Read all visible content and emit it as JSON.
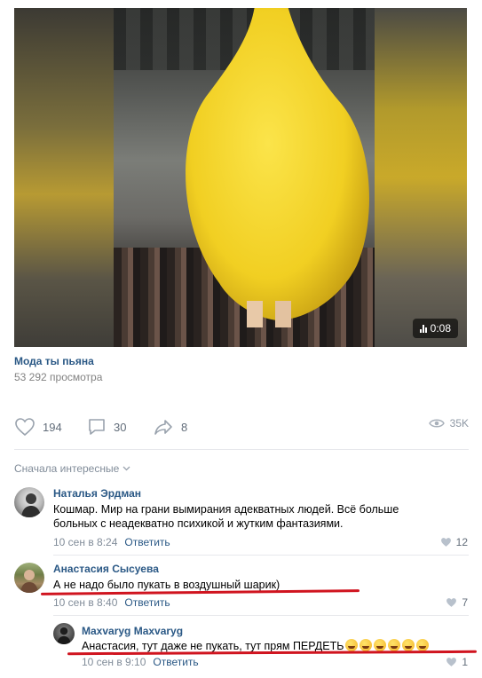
{
  "video": {
    "duration": "0:08",
    "title": "Мода ты пьяна",
    "views": "53 292 просмотра"
  },
  "actions": {
    "likes": "194",
    "comments": "30",
    "shares": "8",
    "views": "35K"
  },
  "comments_section": {
    "sort_label": "Сначала интересные"
  },
  "comments": [
    {
      "author": "Наталья Эрдман",
      "text": "Кошмар. Мир на грани вымирания адекватных людей. Всё больше больных с неадекватно психикой и жутким фантазиями.",
      "date": "10 сен в 8:24",
      "reply_label": "Ответить",
      "likes": "12"
    },
    {
      "author": "Анастасия Сысуева",
      "text": "А не надо было пукать в воздушный шарик)",
      "date": "10 сен в 8:40",
      "reply_label": "Ответить",
      "likes": "7"
    },
    {
      "author": "Maxvaryg Maxvaryg",
      "text": "Анастасия, тут даже не пукать, тут прям ПЕРДЕТЬ",
      "emoji_count": 6,
      "emoji": "rolling-on-floor-laughing",
      "date": "10 сен в 9:10",
      "reply_label": "Ответить",
      "likes": "1"
    }
  ],
  "colors": {
    "link": "#2a5885",
    "muted": "#818c99",
    "highlight": "#d0141f",
    "balloon": "#f2d22c"
  }
}
